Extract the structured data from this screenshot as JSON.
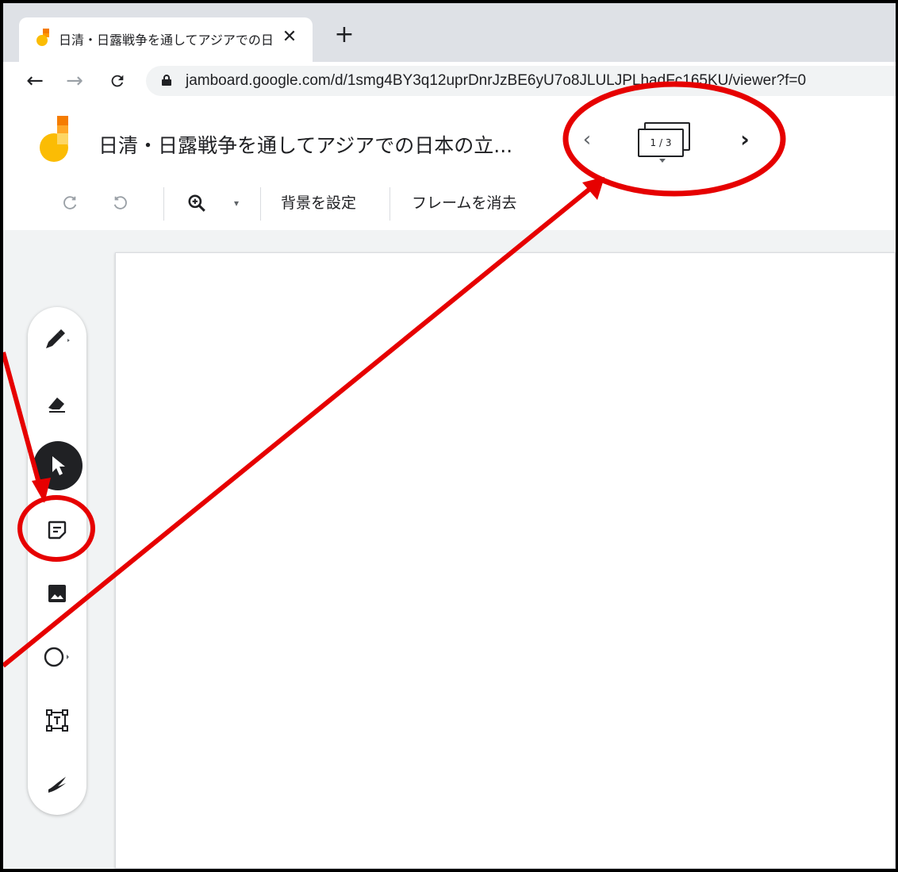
{
  "browser": {
    "tab_title": "日清・日露戦争を通してアジアでの日",
    "tab_close": "✕",
    "new_tab": "+",
    "url": "jamboard.google.com/d/1smg4BY3q12uprDnrJzBE6yU7o8JLULJPLhadFc165KU/viewer?f=0"
  },
  "header": {
    "title": "日清・日露戦争を通してアジアでの日本の立...",
    "frame_counter": "1 / 3",
    "prev": "‹",
    "next": "›"
  },
  "toolbar": {
    "set_background": "背景を設定",
    "clear_frame": "フレームを消去"
  },
  "palette": {
    "tools": [
      "pen-icon",
      "eraser-icon",
      "select-icon",
      "sticky-note-icon",
      "image-icon",
      "circle-icon",
      "text-box-icon",
      "laser-icon"
    ],
    "active_tool": "select-icon"
  },
  "annotations": {
    "color": "#e60000",
    "highlighted": [
      "frame-navigator",
      "sticky-note-tool"
    ]
  }
}
